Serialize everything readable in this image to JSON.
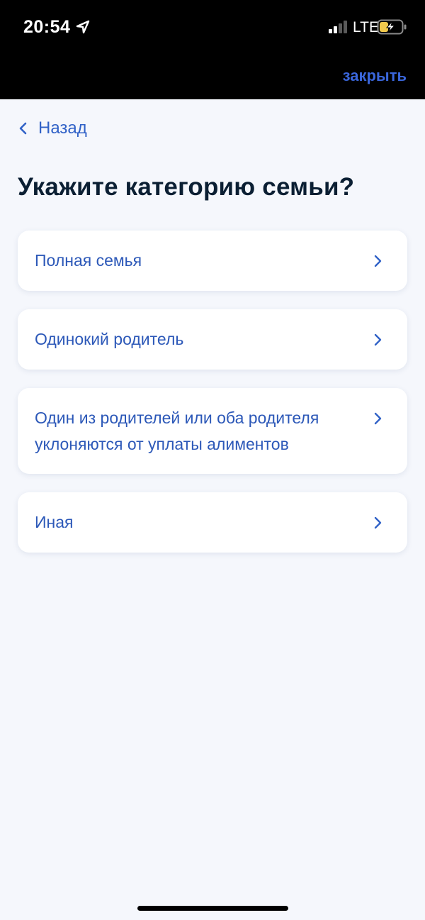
{
  "status_bar": {
    "time": "20:54",
    "network": "LTE",
    "location_icon": "location-arrow-icon",
    "signal_icon": "cellular-signal-icon",
    "battery_icon": "battery-charging-icon",
    "battery_level": 0.35
  },
  "header": {
    "close_label": "закрыть",
    "back_label": "Назад",
    "back_icon": "chevron-left-icon"
  },
  "main": {
    "title": "Укажите категорию семьи?",
    "options": [
      {
        "label": "Полная семья"
      },
      {
        "label": "Одинокий родитель"
      },
      {
        "label": "Один из родителей или оба родителя уклоняются от уплаты алиментов"
      },
      {
        "label": "Иная"
      }
    ]
  },
  "colors": {
    "accent": "#3162c7",
    "close_link": "#3a66db",
    "title": "#0b1f33",
    "background": "#f5f7fc",
    "card": "#ffffff",
    "battery_fill": "#f2c94c"
  }
}
